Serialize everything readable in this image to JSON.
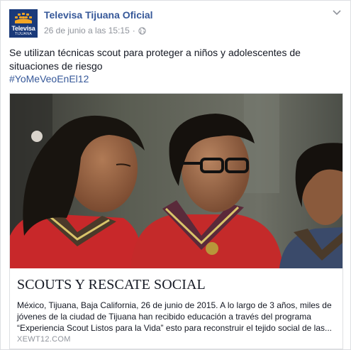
{
  "post": {
    "page_name": "Televisa Tijuana Oficial",
    "timestamp": "26 de junio a las 15:15",
    "separator": "·",
    "message": "Se utilizan técnicas scout para proteger a niños y adolescentes de situaciones de riesgo",
    "hashtag": "#YoMeVeoEnEl12",
    "avatar": {
      "logo_text": "Televisa",
      "logo_sub": "TIJUANA"
    }
  },
  "link_card": {
    "title": "SCOUTS Y RESCATE SOCIAL",
    "description": "México, Tijuana, Baja California, 26 de junio de 2015. A lo largo de 3 años, miles de jóvenes de la ciudad de Tijuana han recibido educación a través del programa “Experiencia Scout Listos para la Vida” esto para reconstruir el tejido social de las...",
    "domain": "XEWT12.COM"
  },
  "icons": {
    "globe": "globe-icon",
    "chevron": "chevron-down-icon"
  },
  "colors": {
    "link_blue": "#365899",
    "meta_gray": "#90949c",
    "avatar_bg": "#1a3a7a"
  }
}
